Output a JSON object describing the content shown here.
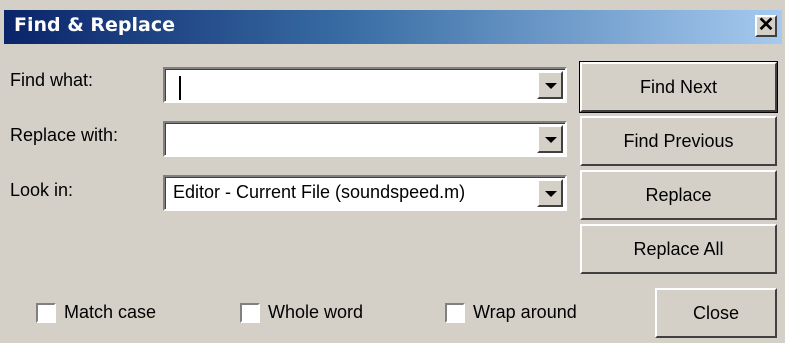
{
  "window": {
    "title": "Find & Replace",
    "close_glyph": "✕"
  },
  "fields": {
    "find_label": "Find what:",
    "find_value": "",
    "replace_label": "Replace with:",
    "replace_value": "",
    "lookin_label": "Look in:",
    "lookin_value": "Editor - Current File (soundspeed.m)"
  },
  "buttons": {
    "find_next": "Find Next",
    "find_previous": "Find Previous",
    "replace": "Replace",
    "replace_all": "Replace All",
    "close": "Close"
  },
  "options": {
    "match_case": {
      "label": "Match case",
      "checked": false
    },
    "whole_word": {
      "label": "Whole word",
      "checked": false
    },
    "wrap_around": {
      "label": "Wrap around",
      "checked": false
    }
  },
  "icons": {
    "dropdown": "chevron-down-icon",
    "close": "close-icon"
  },
  "colors": {
    "titlebar_start": "#0a246a",
    "titlebar_end": "#a6caf0",
    "face": "#d4d0c8"
  }
}
